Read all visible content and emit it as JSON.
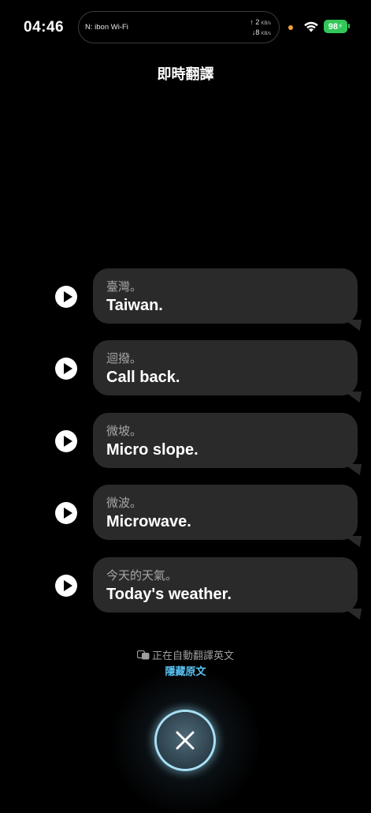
{
  "status_bar": {
    "time": "04:46",
    "network_name": "N: ibon Wi-Fi",
    "upload_speed": "↑ 2",
    "download_speed": "↓8",
    "speed_unit": "KB/s",
    "battery": "98",
    "colors": {
      "battery": "#32c759",
      "indicator_dot": "#f0a23c"
    }
  },
  "header": {
    "title": "即時翻譯"
  },
  "messages": [
    {
      "source": "臺灣。",
      "translation": "Taiwan."
    },
    {
      "source": "迴撥。",
      "translation": "Call back."
    },
    {
      "source": "微坡。",
      "translation": "Micro slope."
    },
    {
      "source": "微波。",
      "translation": "Microwave."
    },
    {
      "source": "今天的天氣。",
      "translation": "Today's weather."
    }
  ],
  "footer": {
    "auto_translate_text": "正在自動翻譯英文",
    "hide_original_label": "隱藏原文",
    "icons": {
      "translate": "translate-icon",
      "close": "close-icon",
      "play": "play-icon"
    },
    "colors": {
      "link": "#5ac8fa",
      "close_ring": "#a8dff3"
    }
  }
}
